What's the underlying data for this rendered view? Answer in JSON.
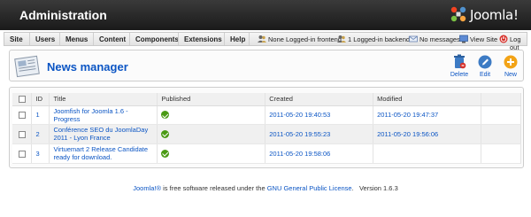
{
  "header": {
    "title": "Administration",
    "logo_text": "Joomla!"
  },
  "menu": {
    "items": [
      "Site",
      "Users",
      "Menus",
      "Content",
      "Components",
      "Extensions",
      "Help"
    ]
  },
  "status": {
    "frontend": "None Logged-in frontend",
    "backend": "1 Logged-in backend",
    "messages": "No messages",
    "view_site": "View Site",
    "logout": "Log out"
  },
  "toolbar": {
    "page_title": "News manager",
    "delete_label": "Delete",
    "edit_label": "Edit",
    "new_label": "New"
  },
  "table": {
    "headers": {
      "id": "ID",
      "title": "Title",
      "published": "Published",
      "created": "Created",
      "modified": "Modified"
    },
    "rows": [
      {
        "id": "1",
        "title_line1": "Joomfish for Joomla 1.6 - Progress",
        "title_line2": "",
        "published": true,
        "created": "2011-05-20 19:40:53",
        "modified": "2011-05-20 19:47:37"
      },
      {
        "id": "2",
        "title_line1": "Conférence SEO du JoomlaDay",
        "title_line2": "2011 - Lyon France",
        "published": true,
        "created": "2011-05-20 19:55:23",
        "modified": "2011-05-20 19:56:06"
      },
      {
        "id": "3",
        "title_line1": "Virtuemart 2 Release Candidate",
        "title_line2": "ready for download.",
        "published": true,
        "created": "2011-05-20 19:58:06",
        "modified": ""
      }
    ]
  },
  "footer": {
    "joomla_link": "Joomla!®",
    "text1": " is free software released under the ",
    "license_link": "GNU General Public License",
    "text2": ".",
    "version": "Version 1.6.3"
  },
  "colors": {
    "link": "#0b55c4",
    "header_bg": "#2a2a2a",
    "published_ok": "#4a9a14"
  }
}
